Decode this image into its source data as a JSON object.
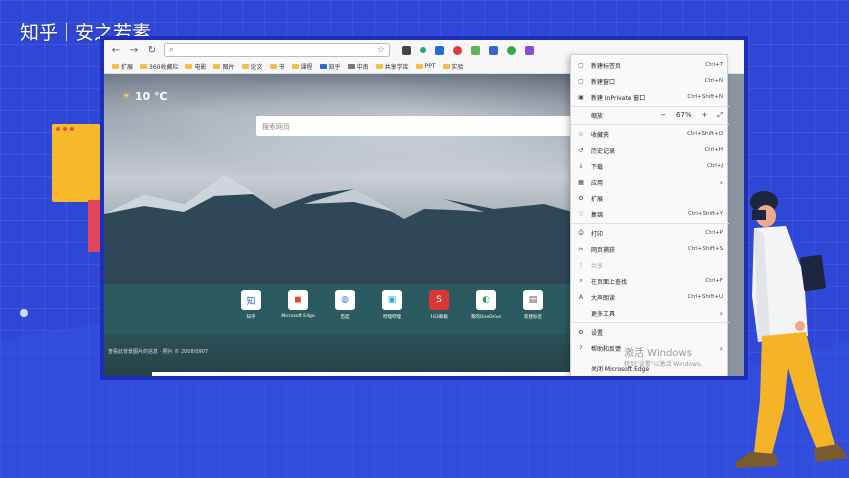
{
  "watermark": {
    "brand": "知乎",
    "author": "安之若素"
  },
  "browser": {
    "weather": {
      "icon": "sun-cloud-icon",
      "temp": "10 ℃"
    },
    "search_placeholder": "搜索网页",
    "bookmarks": [
      "扩展",
      "360收藏栏",
      "电影",
      "图片",
      "论文",
      "书",
      "课程",
      "知乎",
      "中南",
      "共享学库",
      "PPT",
      "实验"
    ],
    "tiles": [
      {
        "label": "知乎",
        "icon": "知"
      },
      {
        "label": "Microsoft Edge",
        "icon": "◼"
      },
      {
        "label": "百度",
        "icon": "◍"
      },
      {
        "label": "哔哩哔哩",
        "icon": "▣"
      },
      {
        "label": "163邮箱",
        "icon": "S"
      },
      {
        "label": "我的OneDrive",
        "icon": "◐"
      },
      {
        "label": "新建标签",
        "icon": "▤"
      }
    ],
    "photo_credit": "查看此背景图片的信息 · 照片 © 2008/0907",
    "menu": [
      {
        "icon": "▢",
        "label": "新建标签页",
        "shortcut": "Ctrl+T"
      },
      {
        "icon": "▢",
        "label": "新建窗口",
        "shortcut": "Ctrl+N"
      },
      {
        "icon": "▣",
        "label": "新建 InPrivate 窗口",
        "shortcut": "Ctrl+Shift+N"
      },
      {
        "icon": "",
        "label": "缩放",
        "zoom": {
          "minus": "−",
          "value": "67%",
          "plus": "+",
          "full": "⤢"
        }
      },
      {
        "icon": "☆",
        "label": "收藏夹",
        "shortcut": "Ctrl+Shift+O"
      },
      {
        "icon": "↺",
        "label": "历史记录",
        "shortcut": "Ctrl+H"
      },
      {
        "icon": "⤓",
        "label": "下载",
        "shortcut": "Ctrl+J"
      },
      {
        "icon": "▦",
        "label": "应用",
        "shortcut": "›"
      },
      {
        "icon": "⚙",
        "label": "扩展",
        "shortcut": ""
      },
      {
        "icon": "♡",
        "label": "集锦",
        "shortcut": "Ctrl+Shift+Y"
      },
      {
        "icon": "⎙",
        "label": "打印",
        "shortcut": "Ctrl+P"
      },
      {
        "icon": "✂",
        "label": "网页捕获",
        "shortcut": "Ctrl+Shift+S"
      },
      {
        "icon": "⇪",
        "label": "共享",
        "shortcut": "",
        "disabled": true
      },
      {
        "icon": "⌕",
        "label": "在页面上查找",
        "shortcut": "Ctrl+F"
      },
      {
        "icon": "A",
        "label": "大声朗读",
        "shortcut": "Ctrl+Shift+U"
      },
      {
        "icon": "",
        "label": "更多工具",
        "shortcut": "›"
      },
      {
        "icon": "⚙",
        "label": "设置",
        "shortcut": ""
      },
      {
        "icon": "?",
        "label": "帮助和反馈",
        "shortcut": "›"
      },
      {
        "icon": "",
        "label": "关闭 Microsoft Edge",
        "shortcut": ""
      }
    ],
    "activate_windows": {
      "line1": "激活 Windows",
      "line2": "转到\"设置\"以激活 Windows。"
    }
  },
  "colors": {
    "background": "#2f47d6",
    "frame": "#1d2fb8",
    "accent_yellow": "#f6b929"
  }
}
